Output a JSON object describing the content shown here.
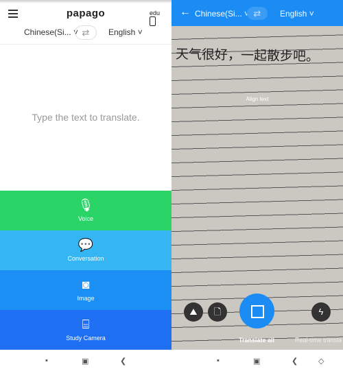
{
  "left": {
    "logo": "papago",
    "edu_label": "edu",
    "source_lang": "Chinese(Si... ˅",
    "target_lang": "English ˅",
    "swap": "⇄",
    "placeholder": "Type the text to translate.",
    "modes": [
      {
        "label": "Voice",
        "icon": "mic-icon",
        "glyph": "🎙",
        "color": "#2ad466"
      },
      {
        "label": "Conversation",
        "icon": "conversation-icon",
        "glyph": "💬",
        "color": "#35b5f2"
      },
      {
        "label": "Image",
        "icon": "image-icon",
        "glyph": "◙",
        "color": "#1b8ff3"
      },
      {
        "label": "Study Camera",
        "icon": "study-camera-icon",
        "glyph": "⌸",
        "color": "#1f6ff2"
      }
    ]
  },
  "right": {
    "source_lang": "Chinese(Si... ˅",
    "target_lang": "English ˅",
    "swap": "⇄",
    "handwriting": "天气很好，一起散步吧。",
    "align_text": "Align text",
    "translate_all": "Translate all",
    "realtime": "Real-time transla"
  },
  "nav": [
    "▪",
    "▣",
    "❮",
    "◇"
  ]
}
